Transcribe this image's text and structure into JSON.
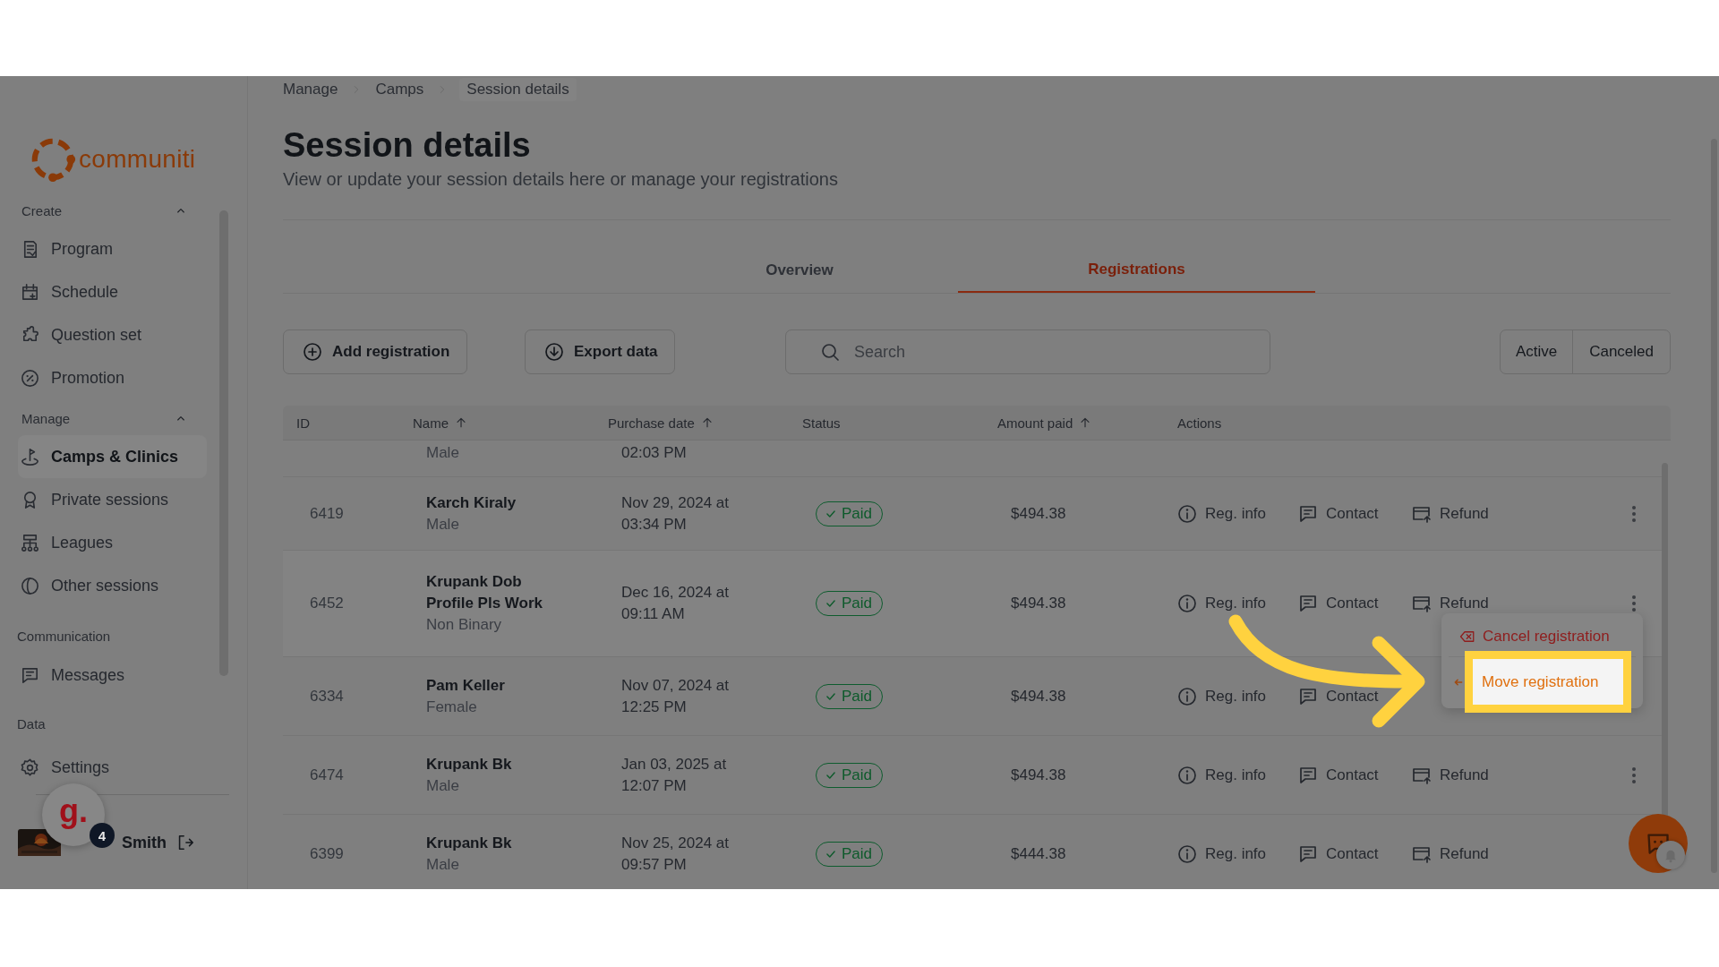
{
  "sidebar": {
    "logo": "communiti",
    "sections": [
      {
        "label": "Create",
        "expanded": true,
        "items": [
          {
            "label": "Program",
            "selected": false
          },
          {
            "label": "Schedule",
            "selected": false
          },
          {
            "label": "Question set",
            "selected": false
          },
          {
            "label": "Promotion",
            "selected": false
          }
        ]
      },
      {
        "label": "Manage",
        "expanded": true,
        "items": [
          {
            "label": "Camps & Clinics",
            "selected": true
          },
          {
            "label": "Private sessions",
            "selected": false
          },
          {
            "label": "Leagues",
            "selected": false
          },
          {
            "label": "Other sessions",
            "selected": false
          }
        ]
      },
      {
        "label": "Communication",
        "items": [
          {
            "label": "Messages",
            "selected": false
          }
        ]
      },
      {
        "label": "Data",
        "items": [
          {
            "label": "Settings",
            "selected": false
          }
        ]
      }
    ],
    "user": {
      "name": "Smith",
      "widget": "g.",
      "widget_badge": "4"
    }
  },
  "breadcrumbs": [
    {
      "label": "Manage",
      "current": false
    },
    {
      "label": "Camps",
      "current": false
    },
    {
      "label": "Session details",
      "current": true
    }
  ],
  "page": {
    "title": "Session details",
    "subtitle": "View or update your session details here or manage your registrations"
  },
  "tabs": [
    {
      "label": "Overview",
      "selected": false
    },
    {
      "label": "Registrations",
      "selected": true
    }
  ],
  "toolbar": {
    "buttons": [
      {
        "label": "Add registration",
        "kind": "add"
      },
      {
        "label": "Export data",
        "kind": "export"
      }
    ],
    "search": {
      "placeholder": "Search"
    },
    "filters": [
      "Active",
      "Canceled"
    ]
  },
  "table": {
    "columns": [
      {
        "label": "ID",
        "sortable": false
      },
      {
        "label": "Name",
        "sortable": true
      },
      {
        "label": "Purchase date",
        "sortable": true
      },
      {
        "label": "Status",
        "sortable": false
      },
      {
        "label": "Amount paid",
        "sortable": true
      },
      {
        "label": "Actions",
        "sortable": false
      }
    ],
    "rows": [
      {
        "kind": "partial",
        "sub": "Male",
        "date": "02:03 PM"
      },
      {
        "kind": "full",
        "id": "6419",
        "name": "Karch Kiraly",
        "sub": "Male",
        "date": "Nov 29, 2024 at 03:34 PM",
        "status": "Paid",
        "amount": "$494.38",
        "actions": [
          "Reg. info",
          "Contact",
          "Refund"
        ],
        "more": true
      },
      {
        "kind": "full",
        "id": "6452",
        "name": "Krupank Dob Profile Pls Work",
        "sub": "Non Binary",
        "date": "Dec 16, 2024 at 09:11 AM",
        "status": "Paid",
        "amount": "$494.38",
        "actions": [
          "Reg. info",
          "Contact",
          "Refund"
        ],
        "more": true,
        "hovered": true,
        "menu": [
          {
            "label": "Cancel registration",
            "kind": "cancel",
            "highlighted": false
          },
          {
            "label": "Move registration",
            "kind": "move",
            "highlighted": true
          }
        ]
      },
      {
        "kind": "full",
        "id": "6334",
        "name": "Pam Keller",
        "sub": "Female",
        "date": "Nov 07, 2024 at 12:25 PM",
        "status": "Paid",
        "amount": "$494.38",
        "actions": [
          "Reg. info",
          "Contact"
        ],
        "more": false
      },
      {
        "kind": "full",
        "id": "6474",
        "name": "Krupank Bk",
        "sub": "Male",
        "date": "Jan 03, 2025 at 12:07 PM",
        "status": "Paid",
        "amount": "$494.38",
        "actions": [
          "Reg. info",
          "Contact",
          "Refund"
        ],
        "more": true
      },
      {
        "kind": "full",
        "id": "6399",
        "name": "Krupank Bk",
        "sub": "Male",
        "date": "Nov 25, 2024 at 09:57 PM",
        "status": "Paid",
        "amount": "$444.38",
        "actions": [
          "Reg. info",
          "Contact",
          "Refund"
        ],
        "more": false
      }
    ]
  }
}
